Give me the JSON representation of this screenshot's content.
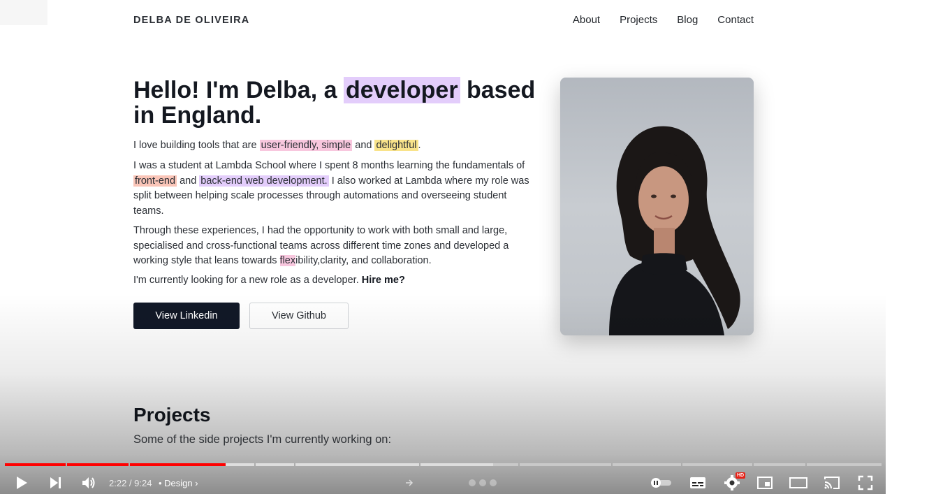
{
  "site": {
    "brand": "DELBA DE OLIVEIRA",
    "nav": [
      "About",
      "Projects",
      "Blog",
      "Contact"
    ]
  },
  "hero": {
    "title_a": "Hello! I'm Delba, a ",
    "title_highlight": "developer",
    "title_b": " based in England.",
    "p1_a": "I love building tools that are ",
    "p1_hl1": "user-friendly, simple",
    "p1_b": " and ",
    "p1_hl2": "delightful",
    "p1_c": ".",
    "p2_a": "I was a student at Lambda School where I spent 8 months learning the fundamentals of ",
    "p2_hl1": "front-end",
    "p2_b": " and ",
    "p2_hl2": "back-end web development.",
    "p2_c": " I also worked at Lambda where my role was split between helping scale processes through automations and overseeing student teams.",
    "p3_a": "Through these experiences, I had the opportunity to work with both small and large, specialised and cross-functional teams across different time zones and developed a working style that leans towards ",
    "p3_hl": "flex",
    "p3_b": "ibility,clarity, and collaboration.",
    "p4_a": "I'm currently looking for a new role as a developer. ",
    "p4_bold": "Hire me?",
    "btn_linkedin": "View Linkedin",
    "btn_github": "View Github"
  },
  "projects": {
    "title": "Projects",
    "subtitle": "Some of the side projects I'm currently working on:"
  },
  "player": {
    "time": "2:22 / 9:24",
    "chapter": "• Design",
    "quality_badge": "HD",
    "progress_fraction": 0.2518,
    "accent": "#ff0000"
  }
}
